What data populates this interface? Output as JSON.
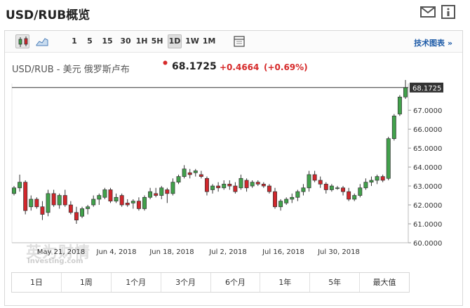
{
  "page": {
    "title": "USD/RUB概览"
  },
  "icons": {
    "mail": "mail-icon",
    "info": "info-icon"
  },
  "toolbar": {
    "chart_type_icons": [
      "candlestick-icon",
      "area-chart-icon"
    ],
    "intervals": [
      "1",
      "5",
      "15",
      "30",
      "1H",
      "5H",
      "1D",
      "1W",
      "1M"
    ],
    "active_interval": "1D",
    "layout_icon": "layout-icon",
    "tech_chart_label": "技术图表 »"
  },
  "quote": {
    "name": "USD/RUB - 美元 俄罗斯卢布",
    "price": "68.1725",
    "change": "+0.4664",
    "change_pct": "(+0.69%)",
    "direction_color": "#d62a2a"
  },
  "watermark": {
    "brand": "英为财情",
    "sub": "Investing.com"
  },
  "range_buttons": [
    "1日",
    "1周",
    "1个月",
    "3个月",
    "6个月",
    "1年",
    "5年",
    "最大值"
  ],
  "colors": {
    "up": "#41a14b",
    "down": "#d1272c",
    "line": "#333333"
  },
  "chart_data": {
    "type": "candlestick",
    "current_price_label": "68.1725",
    "y_ticks": [
      "67.0000",
      "66.0000",
      "65.0000",
      "64.0000",
      "63.0000",
      "62.0000",
      "61.0000",
      "60.0000"
    ],
    "ylim": [
      60,
      68.6
    ],
    "x_ticks": [
      "May 21, 2018",
      "Jun 4, 2018",
      "Jun 18, 2018",
      "Jul 2, 2018",
      "Jul 16, 2018",
      "Jul 30, 2018"
    ],
    "candles": [
      [
        62.6,
        63.0,
        62.5,
        62.9
      ],
      [
        62.9,
        63.6,
        62.7,
        63.2
      ],
      [
        63.2,
        63.3,
        61.5,
        61.7
      ],
      [
        61.9,
        62.5,
        61.7,
        62.3
      ],
      [
        62.3,
        62.4,
        61.8,
        61.9
      ],
      [
        61.9,
        62.2,
        61.2,
        61.5
      ],
      [
        61.6,
        62.8,
        61.4,
        62.6
      ],
      [
        62.6,
        62.8,
        61.9,
        62.0
      ],
      [
        62.0,
        62.6,
        61.8,
        62.5
      ],
      [
        62.5,
        62.8,
        61.9,
        62.0
      ],
      [
        62.0,
        62.2,
        61.5,
        61.6
      ],
      [
        61.6,
        61.9,
        61.0,
        61.2
      ],
      [
        61.4,
        61.9,
        61.3,
        61.8
      ],
      [
        61.8,
        62.0,
        61.5,
        61.9
      ],
      [
        62.0,
        62.5,
        61.9,
        62.3
      ],
      [
        62.3,
        62.6,
        62.0,
        62.5
      ],
      [
        62.4,
        62.9,
        62.3,
        62.8
      ],
      [
        62.8,
        62.9,
        62.1,
        62.2
      ],
      [
        62.2,
        62.6,
        62.1,
        62.4
      ],
      [
        62.5,
        62.6,
        61.9,
        62.0
      ],
      [
        62.1,
        62.3,
        61.9,
        62.0
      ],
      [
        62.1,
        62.3,
        61.8,
        62.2
      ],
      [
        62.2,
        62.4,
        61.7,
        61.8
      ],
      [
        61.8,
        62.5,
        61.7,
        62.4
      ],
      [
        62.4,
        62.9,
        62.3,
        62.7
      ],
      [
        62.6,
        62.9,
        62.4,
        62.5
      ],
      [
        62.5,
        63.0,
        62.3,
        62.9
      ],
      [
        62.8,
        62.9,
        62.1,
        62.6
      ],
      [
        62.6,
        63.4,
        62.5,
        63.2
      ],
      [
        63.2,
        63.6,
        63.1,
        63.5
      ],
      [
        63.5,
        64.1,
        63.4,
        63.9
      ],
      [
        63.7,
        63.9,
        63.4,
        63.6
      ],
      [
        63.7,
        63.9,
        63.5,
        63.8
      ],
      [
        63.6,
        63.8,
        63.4,
        63.5
      ],
      [
        63.4,
        63.5,
        62.5,
        62.7
      ],
      [
        62.8,
        63.1,
        62.6,
        63.0
      ],
      [
        63.0,
        63.2,
        62.7,
        62.9
      ],
      [
        62.9,
        63.3,
        62.8,
        63.1
      ],
      [
        63.1,
        63.3,
        62.8,
        63.0
      ],
      [
        63.0,
        63.2,
        62.6,
        62.7
      ],
      [
        62.9,
        63.6,
        62.8,
        63.4
      ],
      [
        63.3,
        63.4,
        62.7,
        62.9
      ],
      [
        63.0,
        63.3,
        62.9,
        63.2
      ],
      [
        63.2,
        63.3,
        63.0,
        63.1
      ],
      [
        63.1,
        63.2,
        62.9,
        63.0
      ],
      [
        63.0,
        63.1,
        62.6,
        62.7
      ],
      [
        62.7,
        62.9,
        61.8,
        61.9
      ],
      [
        61.9,
        62.3,
        61.7,
        62.2
      ],
      [
        62.1,
        62.4,
        62.0,
        62.3
      ],
      [
        62.3,
        62.6,
        62.1,
        62.4
      ],
      [
        62.4,
        62.8,
        62.2,
        62.7
      ],
      [
        62.7,
        63.1,
        62.5,
        62.9
      ],
      [
        62.9,
        63.8,
        62.7,
        63.6
      ],
      [
        63.6,
        63.8,
        63.2,
        63.3
      ],
      [
        63.3,
        63.5,
        62.9,
        63.1
      ],
      [
        63.1,
        63.2,
        62.6,
        62.8
      ],
      [
        62.8,
        63.1,
        62.7,
        63.0
      ],
      [
        62.9,
        63.0,
        62.8,
        62.9
      ],
      [
        62.9,
        63.0,
        62.5,
        62.7
      ],
      [
        62.7,
        62.9,
        62.2,
        62.3
      ],
      [
        62.3,
        62.6,
        62.2,
        62.5
      ],
      [
        62.5,
        63.1,
        62.4,
        62.9
      ],
      [
        62.9,
        63.4,
        62.8,
        63.2
      ],
      [
        63.2,
        63.5,
        63.0,
        63.3
      ],
      [
        63.3,
        63.6,
        63.1,
        63.5
      ],
      [
        63.5,
        63.6,
        63.2,
        63.3
      ],
      [
        63.4,
        65.6,
        63.3,
        65.5
      ],
      [
        65.5,
        66.8,
        65.4,
        66.7
      ],
      [
        66.8,
        67.8,
        66.7,
        67.7
      ],
      [
        67.7,
        68.6,
        67.6,
        68.2
      ]
    ]
  }
}
